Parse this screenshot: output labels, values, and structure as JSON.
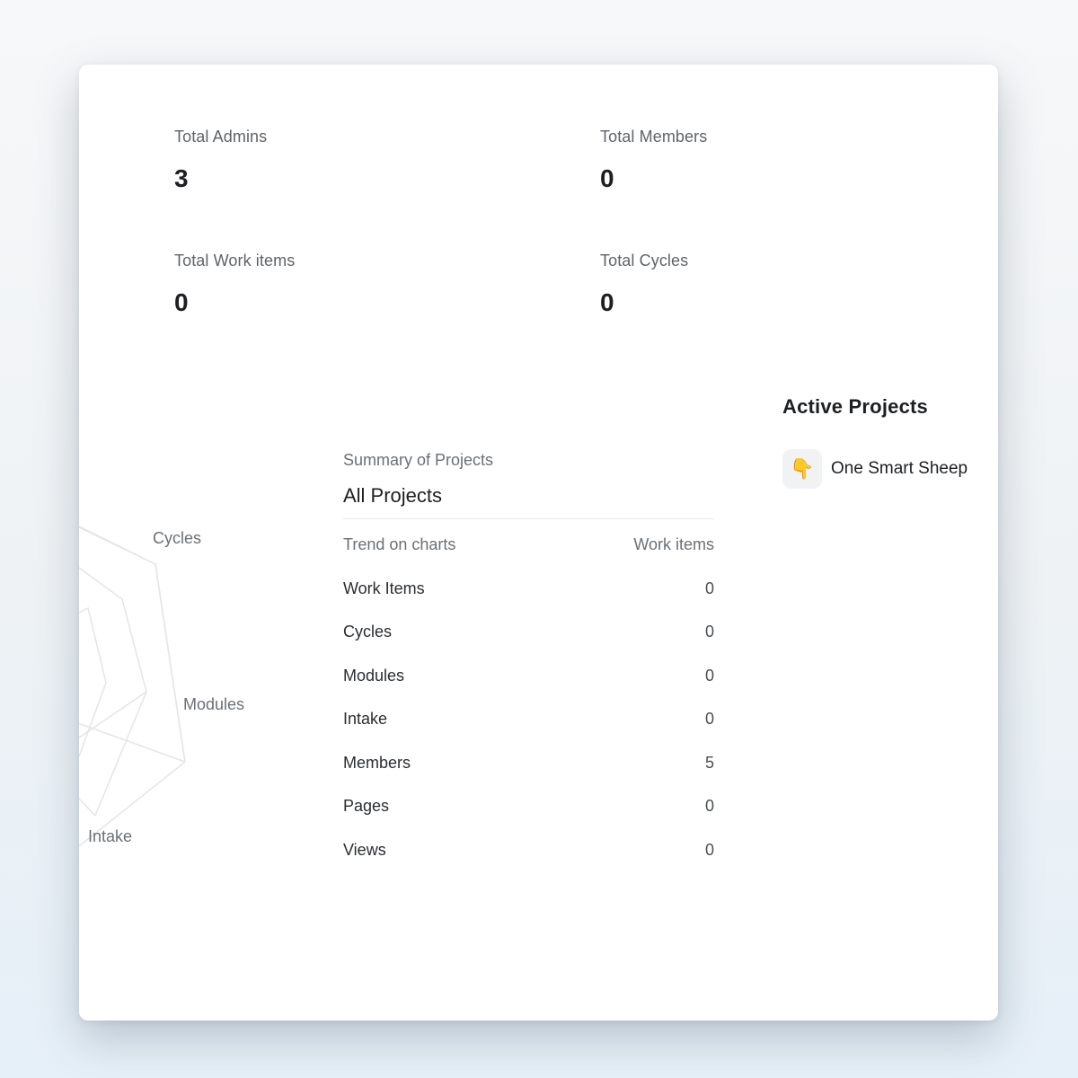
{
  "stats": {
    "admins": {
      "label": "Total Admins",
      "value": "3"
    },
    "members": {
      "label": "Total Members",
      "value": "0"
    },
    "work_items": {
      "label": "Total Work items",
      "value": "0"
    },
    "cycles": {
      "label": "Total Cycles",
      "value": "0"
    }
  },
  "radar": {
    "labels": {
      "cycles": "Cycles",
      "modules": "Modules",
      "intake": "Intake"
    }
  },
  "summary": {
    "caption": "Summary of Projects",
    "title": "All Projects",
    "header_left": "Trend on charts",
    "header_right": "Work items",
    "rows": [
      {
        "label": "Work Items",
        "value": "0"
      },
      {
        "label": "Cycles",
        "value": "0"
      },
      {
        "label": "Modules",
        "value": "0"
      },
      {
        "label": "Intake",
        "value": "0"
      },
      {
        "label": "Members",
        "value": "5"
      },
      {
        "label": "Pages",
        "value": "0"
      },
      {
        "label": "Views",
        "value": "0"
      }
    ]
  },
  "active_projects": {
    "title": "Active Projects",
    "items": [
      {
        "emoji": "👇",
        "name": "One Smart Sheep"
      }
    ]
  },
  "colors": {
    "grid": "#e3e5e7",
    "text": "#1d1f22",
    "muted": "#6b7075"
  }
}
